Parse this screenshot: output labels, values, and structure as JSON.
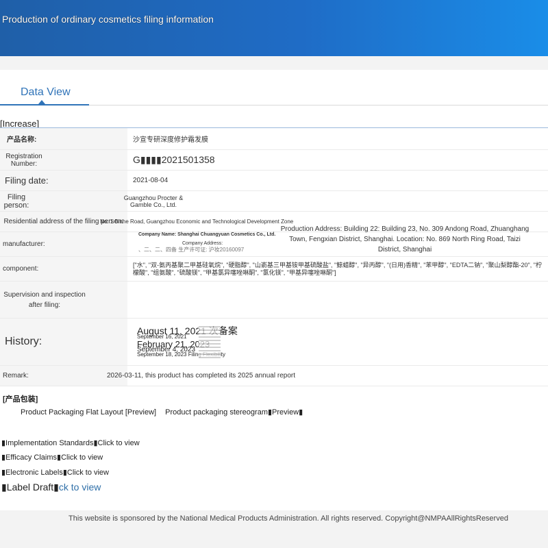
{
  "banner": {
    "title": "Production of ordinary cosmetics filing information"
  },
  "tabs": [
    {
      "label": "Data View"
    }
  ],
  "section": {
    "label": "[Increase]"
  },
  "fields": {
    "product_name": {
      "label": "产品名称:",
      "value": "沙宣专研深度修护霜发膜"
    },
    "registration_number": {
      "label": "Registration Number:",
      "value": "G▮▮▮▮2021501358"
    },
    "filing_date": {
      "label": "Filing date:",
      "value": "2021-08-04"
    },
    "filing_person": {
      "label": "Filing person:",
      "value": "Guangzhou Procter & Gamble Co., Ltd."
    },
    "residential_address": {
      "label": "Residential address of the filing person:",
      "value": "No. 1 Binhe Road, Guangzhou Economic and Technological Development Zone"
    },
    "manufacturer": {
      "label": "manufacturer:",
      "company_name": "Company Name: Shanghai Chuangyuan Cosmetics Co., Ltd.",
      "company_address_label": "Company Address:",
      "license_text": "、二、二、四备 生产许可证: 沪妆20160097",
      "production_address": "Production Address: Building 22: Building 23, No. 309 Andong Road, Zhuanghang Town, Fengxian District, Shanghai. Location: No. 869 North Ring Road, Taizi District, Shanghai"
    },
    "component": {
      "label": "component:",
      "value": "[\"水\", \"双-氨丙基聚二甲基硅氧烷\", \"硬脂醇\", \"山嵛基三甲基铵甲基硫酸盐\", \"鲸蜡醇\", \"异丙醇\", \"(日用)香精\", \"苯甲醇\", \"EDTA二钠\", \"聚山梨醇酯-20\", \"柠檬酸\", \"组氨酸\", \"硫酸镁\", \"甲基氯异噻唑啉酮\", \"氯化镁\", \"甲基异噻唑啉酮\"]"
    },
    "supervision": {
      "label": "Supervision and inspection after filing:",
      "value": ""
    },
    "history": {
      "label": "History:",
      "entries": [
        "August 11, 2021 次备案",
        "September 16, 2021",
        "February 21, 2023",
        "September 4, 2023",
        "September 18, 2023 Filing Flexibility"
      ]
    },
    "remark": {
      "label": "Remark:",
      "value": "2026-03-11, this product has completed its 2025 annual report"
    }
  },
  "packaging": {
    "title": "[产品包装]",
    "flat_layout": "Product Packaging Flat Layout [Preview]",
    "stereogram": "Product packaging stereogram▮Preview▮"
  },
  "docs": [
    {
      "label": "▮Implementation Standards▮",
      "link": "Click to view"
    },
    {
      "label": "▮Efficacy Claims▮",
      "link": "Click to view"
    },
    {
      "label": "▮Electronic Labels▮",
      "link": "Click to view"
    },
    {
      "label": "▮Label Draft▮",
      "link": "ck to view"
    }
  ],
  "footer": {
    "text": "This website is sponsored by the National Medical Products Administration. All rights reserved. Copyright@NMPAAllRightsReserved"
  }
}
